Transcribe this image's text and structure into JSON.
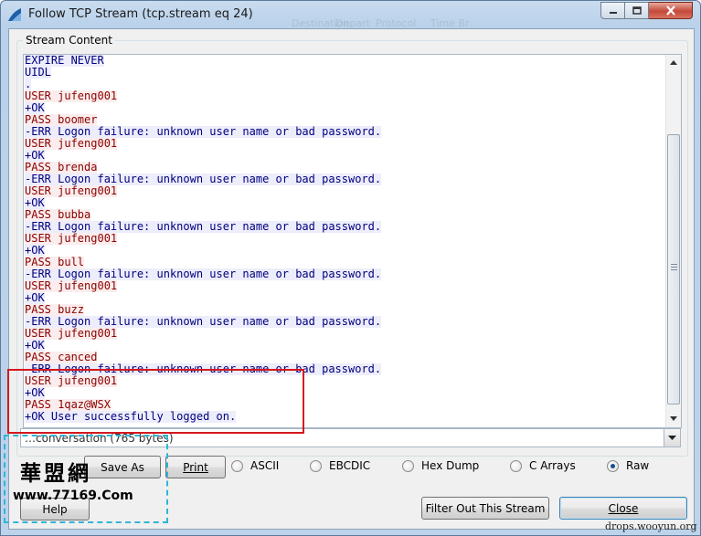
{
  "window": {
    "title": "Follow TCP Stream (tcp.stream eq 24)",
    "behind_labels": [
      "Destination",
      "Depart",
      "Protocol",
      "Time Br"
    ]
  },
  "stream": {
    "group_label": "Stream Content",
    "lines": [
      {
        "text": "EXPIRE NEVER",
        "dir": "server"
      },
      {
        "text": "UIDL",
        "dir": "server"
      },
      {
        "text": ".",
        "dir": "server"
      },
      {
        "text": "USER jufeng001",
        "dir": "client"
      },
      {
        "text": "+OK",
        "dir": "server"
      },
      {
        "text": "PASS boomer",
        "dir": "client"
      },
      {
        "text": "-ERR Logon failure: unknown user name or bad password.",
        "dir": "server"
      },
      {
        "text": "USER jufeng001",
        "dir": "client"
      },
      {
        "text": "+OK",
        "dir": "server"
      },
      {
        "text": "PASS brenda",
        "dir": "client"
      },
      {
        "text": "-ERR Logon failure: unknown user name or bad password.",
        "dir": "server"
      },
      {
        "text": "USER jufeng001",
        "dir": "client"
      },
      {
        "text": "+OK",
        "dir": "server"
      },
      {
        "text": "PASS bubba",
        "dir": "client"
      },
      {
        "text": "-ERR Logon failure: unknown user name or bad password.",
        "dir": "server"
      },
      {
        "text": "USER jufeng001",
        "dir": "client"
      },
      {
        "text": "+OK",
        "dir": "server"
      },
      {
        "text": "PASS bull",
        "dir": "client"
      },
      {
        "text": "-ERR Logon failure: unknown user name or bad password.",
        "dir": "server"
      },
      {
        "text": "USER jufeng001",
        "dir": "client"
      },
      {
        "text": "+OK",
        "dir": "server"
      },
      {
        "text": "PASS buzz",
        "dir": "client"
      },
      {
        "text": "-ERR Logon failure: unknown user name or bad password.",
        "dir": "server"
      },
      {
        "text": "USER jufeng001",
        "dir": "client"
      },
      {
        "text": "+OK",
        "dir": "server"
      },
      {
        "text": "PASS canced",
        "dir": "client"
      },
      {
        "text": "-ERR Logon failure: unknown user name or bad password.",
        "dir": "server"
      },
      {
        "text": "USER jufeng001",
        "dir": "client"
      },
      {
        "text": "+OK",
        "dir": "server"
      },
      {
        "text": "PASS 1qaz@WSX",
        "dir": "client"
      },
      {
        "text": "+OK User successfully logged on.",
        "dir": "server"
      }
    ],
    "colors": {
      "client_text": "#8b0000",
      "client_bg": "#fbeded",
      "server_text": "#00007f",
      "server_bg": "#ededfb"
    }
  },
  "conversation": {
    "selected": "…conversation (765 bytes)"
  },
  "buttons": {
    "save_as": "Save As",
    "print_label": "Print",
    "help": "Help",
    "filter_out": "Filter Out This Stream",
    "close": "Close"
  },
  "formats": {
    "selected": "Raw",
    "options": [
      "ASCII",
      "EBCDIC",
      "Hex Dump",
      "C Arrays",
      "Raw"
    ]
  },
  "watermark": {
    "title": "華盟網",
    "url": "www.77169.Com",
    "credit": "drops.wooyun.org"
  },
  "highlight": {
    "color": "#d4181f"
  }
}
